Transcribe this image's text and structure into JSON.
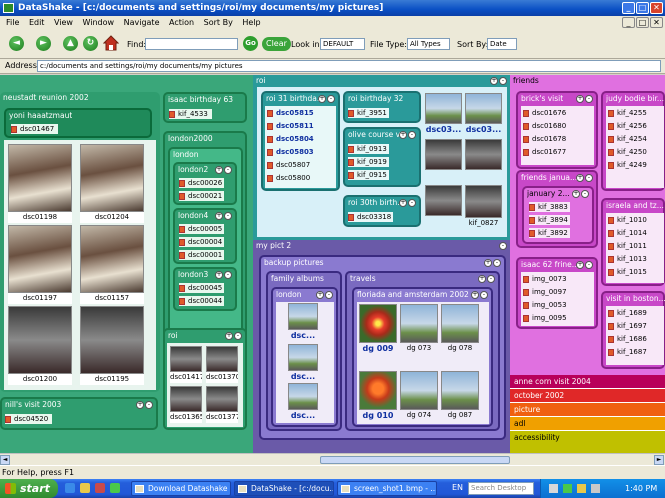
{
  "window": {
    "title": "DataShake - [c:/documents and settings/roi/my documents/my pictures]",
    "min": "_",
    "max": "□",
    "close": "✕",
    "min2": "_",
    "max2": "□",
    "close2": "✕"
  },
  "menu": [
    "File",
    "Edit",
    "View",
    "Window",
    "Navigate",
    "Action",
    "Sort By",
    "Help"
  ],
  "toolbar": {
    "back": "◄",
    "forward": "►",
    "up": "▲",
    "refresh": "↻",
    "find_label": "Find:",
    "find_value": "",
    "go": "Go",
    "clear": "Clear",
    "look_in_label": "Look in:",
    "look_in_value": "DEFAULT",
    "file_type_label": "File Type:",
    "file_type_value": "All Types",
    "sort_by_label": "Sort By:",
    "sort_by_value": "Date"
  },
  "address": {
    "label": "Address",
    "value": "c:/documents and settings/roi/my documents/my pictures"
  },
  "panels": {
    "neustadt": {
      "title": "neustadt reunion 2002"
    },
    "yoni": {
      "title": "yoni haaatzmaut",
      "files": [
        "dsc01467"
      ]
    },
    "neustadt_thumbs": [
      "dsc01198",
      "dsc01204",
      "dsc01197",
      "dsc01157",
      "dsc01200",
      "dsc01195"
    ],
    "nills": {
      "title": "nill's visit 2003",
      "files": [
        "dsc04520"
      ]
    },
    "isaac63": {
      "title": "isaac birthday 63",
      "files": [
        "kif_4533"
      ]
    },
    "london2000": {
      "title": "london2000"
    },
    "london": {
      "title": "london"
    },
    "london2": {
      "title": "london2",
      "files": [
        "dsc00026",
        "dsc00021"
      ]
    },
    "london4": {
      "title": "london4",
      "files": [
        "dsc00005",
        "dsc00004",
        "dsc00001"
      ]
    },
    "london3": {
      "title": "london3",
      "files": [
        "dsc00045",
        "dsc00044"
      ]
    },
    "roi_small": {
      "title": "roi",
      "thumbs": [
        "dsc01417",
        "dsc01370",
        "dsc01365",
        "dsc01377"
      ]
    },
    "roi": {
      "title": "roi"
    },
    "roi31": {
      "title": "roi 31 birthda...",
      "bold_files": [
        "dsc05815",
        "dsc05811",
        "dsc05804",
        "dsc05803"
      ],
      "files": [
        "dsc05807",
        "dsc05800"
      ]
    },
    "roi32": {
      "title": "roi birthday 32",
      "files": [
        "kif_3951"
      ]
    },
    "olive": {
      "title": "olive course v...",
      "files": [
        "kif_0913",
        "kif_0919",
        "kif_0915"
      ]
    },
    "roi30": {
      "title": "roi 30th birth...",
      "files": [
        "dsc03318"
      ]
    },
    "roi_thumbs": [
      "dsc03...",
      "dsc03...",
      "kif_0827"
    ],
    "mypict2": {
      "title": "my pict 2"
    },
    "backup": {
      "title": "backup pictures"
    },
    "family": {
      "title": "family albums"
    },
    "family_london": {
      "title": "london",
      "thumbs": [
        "dsc...",
        "dsc...",
        "dsc..."
      ]
    },
    "travels": {
      "title": "travels"
    },
    "floriada": {
      "title": "floriada and amsterdam 2002",
      "thumbs": [
        "dg 009",
        "dg 073",
        "dg 078",
        "dg 010",
        "dg 074",
        "dg 087"
      ]
    },
    "friends": {
      "title": "friends"
    },
    "brick": {
      "title": "brick's visit",
      "files": [
        "dsc01676",
        "dsc01680",
        "dsc01678",
        "dsc01677"
      ]
    },
    "judy": {
      "title": "judy bodie bir...",
      "files": [
        "kif_4255",
        "kif_4256",
        "kif_4254",
        "kif_4250",
        "kif_4249"
      ]
    },
    "friends_jan": {
      "title": "friends janua..."
    },
    "january2": {
      "title": "january 2...",
      "files": [
        "kif_3883",
        "kif_3894",
        "kif_3892"
      ]
    },
    "israela": {
      "title": "israela and tz...",
      "files": [
        "kif_1010",
        "kif_1014",
        "kif_1011",
        "kif_1013",
        "kif_1015"
      ]
    },
    "isaac62": {
      "title": "isaac 62 frine...",
      "files": [
        "img_0073",
        "img_0097",
        "img_0053",
        "img_0095"
      ]
    },
    "boston": {
      "title": "visit in boston...",
      "files": [
        "kif_1689",
        "kif_1697",
        "kif_1686",
        "kif_1687"
      ]
    }
  },
  "strips": [
    {
      "label": "anne corn visit 2004",
      "color": "#b8005a"
    },
    {
      "label": "october 2002",
      "color": "#e02828"
    },
    {
      "label": "picture",
      "color": "#f06010"
    },
    {
      "label": "adl",
      "color": "#f0a000"
    },
    {
      "label": "accessibility",
      "color": "#c0c000"
    }
  ],
  "status": "For Help, press F1",
  "taskbar": {
    "start": "start",
    "tasks": [
      "Download Datashake ...",
      "DataShake - [c:/docu...",
      "screen_shot1.bmp - ..."
    ],
    "lang": "EN",
    "search": "Search Desktop",
    "time": "1:40 PM"
  },
  "colors": {
    "green": "#2f9d6f",
    "teal": "#2a9a9a",
    "purple": "#6a5aa8",
    "magenta": "#c848c8"
  }
}
